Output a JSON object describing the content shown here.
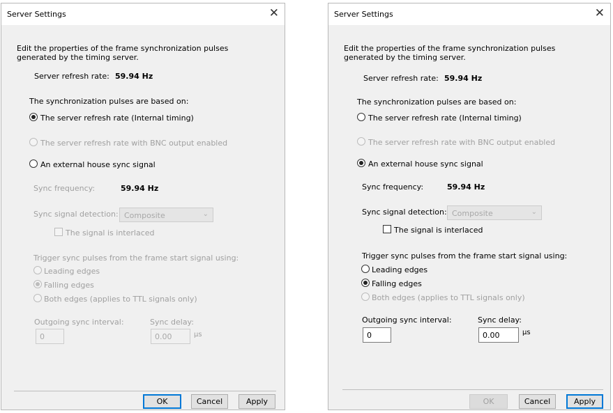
{
  "left": {
    "title": "Server Settings",
    "close_glyph": "✕",
    "description": "Edit the properties of the frame synchronization pulses generated by the timing server.",
    "refresh_label": "Server refresh rate:",
    "refresh_value": "59.94 Hz",
    "based_on_label": "The synchronization pulses are based on:",
    "opt_internal": "The server refresh rate (Internal timing)",
    "opt_bnc": "The server refresh rate with BNC output enabled",
    "opt_house": "An external house sync signal",
    "sync_freq_label": "Sync frequency:",
    "sync_freq_value": "59.94 Hz",
    "detection_label": "Sync signal detection:",
    "detection_value": "Composite",
    "interlaced_label": "The signal is interlaced",
    "trigger_label": "Trigger sync pulses from the frame start signal using:",
    "edge_leading": "Leading edges",
    "edge_falling": "Falling edges",
    "edge_both": "Both edges (applies to TTL signals only)",
    "interval_label": "Outgoing sync interval:",
    "interval_value": "0",
    "delay_label": "Sync delay:",
    "delay_value": "0.00",
    "delay_unit": "µs",
    "ok": "OK",
    "cancel": "Cancel",
    "apply": "Apply"
  },
  "right": {
    "title": "Server Settings",
    "close_glyph": "✕",
    "description": "Edit the properties of the frame synchronization pulses generated by the timing server.",
    "refresh_label": "Server refresh rate:",
    "refresh_value": "59.94 Hz",
    "based_on_label": "The synchronization pulses are based on:",
    "opt_internal": "The server refresh rate (Internal timing)",
    "opt_bnc": "The server refresh rate with BNC output enabled",
    "opt_house": "An external house sync signal",
    "sync_freq_label": "Sync frequency:",
    "sync_freq_value": "59.94 Hz",
    "detection_label": "Sync signal detection:",
    "detection_value": "Composite",
    "interlaced_label": "The signal is interlaced",
    "trigger_label": "Trigger sync pulses from the frame start signal using:",
    "edge_leading": "Leading edges",
    "edge_falling": "Falling edges",
    "edge_both": "Both edges (applies to TTL signals only)",
    "interval_label": "Outgoing sync interval:",
    "interval_value": "0",
    "delay_label": "Sync delay:",
    "delay_value": "0.00",
    "delay_unit": "µs",
    "ok": "OK",
    "cancel": "Cancel",
    "apply": "Apply"
  }
}
